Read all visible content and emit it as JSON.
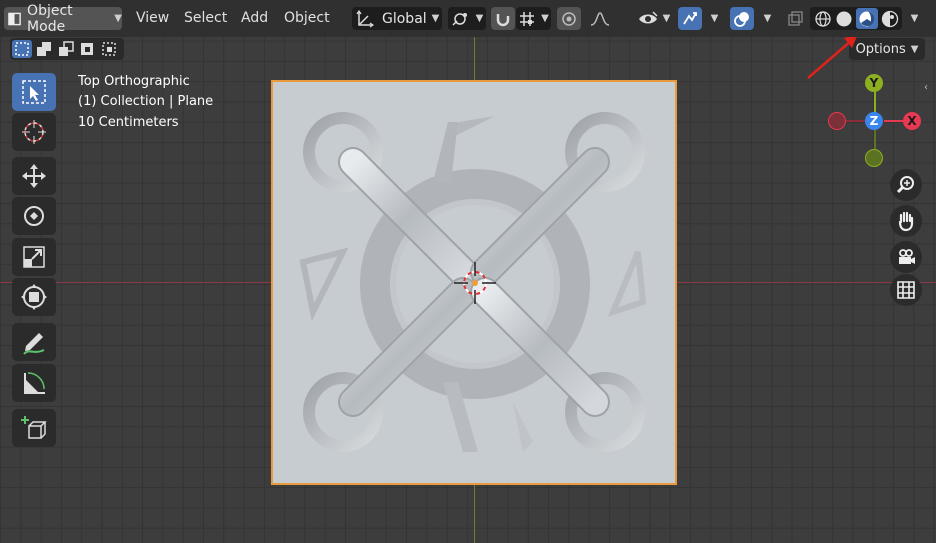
{
  "header": {
    "mode_label": "Object Mode",
    "menus": [
      "View",
      "Select",
      "Add",
      "Object"
    ],
    "orientation_label": "Global",
    "options_label": "Options"
  },
  "overlay": {
    "view_name": "Top Orthographic",
    "collection_info": "(1) Collection | Plane",
    "grid_scale": "10 Centimeters"
  },
  "gizmo": {
    "y_label": "Y",
    "z_label": "Z",
    "x_label": "X"
  },
  "colors": {
    "accent": "#4772b3",
    "selection_outline": "#e99a3d",
    "x_axis": "#e63952",
    "y_axis": "#8cb01f",
    "z_axis": "#3a86ef",
    "annotation_arrow": "#e0221c"
  },
  "icons": {
    "toolbar": [
      "select-box-icon",
      "cursor-icon",
      "move-icon",
      "rotate-icon",
      "scale-icon",
      "transform-icon",
      "annotate-icon",
      "measure-icon",
      "add-cube-icon"
    ],
    "navigation": [
      "zoom-icon",
      "pan-hand-icon",
      "camera-icon",
      "grid-icon"
    ],
    "shading": [
      "wireframe-icon",
      "solid-icon",
      "material-preview-icon",
      "rendered-icon"
    ]
  },
  "shading": {
    "active": "material-preview"
  }
}
